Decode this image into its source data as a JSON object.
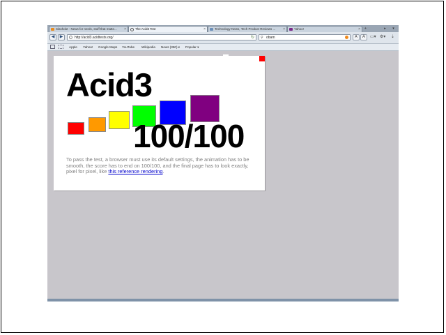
{
  "tabs": [
    {
      "title": "Slashdot - News for nerds, stuff that matte...",
      "active": false
    },
    {
      "title": "The Acid3 Test",
      "active": true
    },
    {
      "title": "Technology News, Tech Product Reviews ...",
      "active": false
    },
    {
      "title": "Yahoo!",
      "active": false
    }
  ],
  "navbar": {
    "back": "◀",
    "forward": "▶",
    "url": "http://acid3.acidtests.org/",
    "search_value": "obam",
    "zoom_small": "A",
    "zoom_large": "A"
  },
  "bookmarks": [
    "Apple",
    "Yahoo!",
    "Google Maps",
    "YouTube",
    "Wikipedia",
    "News (350) ▾",
    "Popular ▾"
  ],
  "page": {
    "title": "Acid3",
    "score": "100/100",
    "description_before": "To pass the test, a browser must use its default settings, the animation has to be smooth, the score has to end on 100/100, and the final page has to look exactly, pixel for pixel, like ",
    "link_text": "this reference rendering",
    "description_after": ".",
    "squares": [
      {
        "color": "#ff0000"
      },
      {
        "color": "#ff9900"
      },
      {
        "color": "#ffff00"
      },
      {
        "color": "#00ff00"
      },
      {
        "color": "#0000ff"
      },
      {
        "color": "#800080"
      }
    ]
  }
}
